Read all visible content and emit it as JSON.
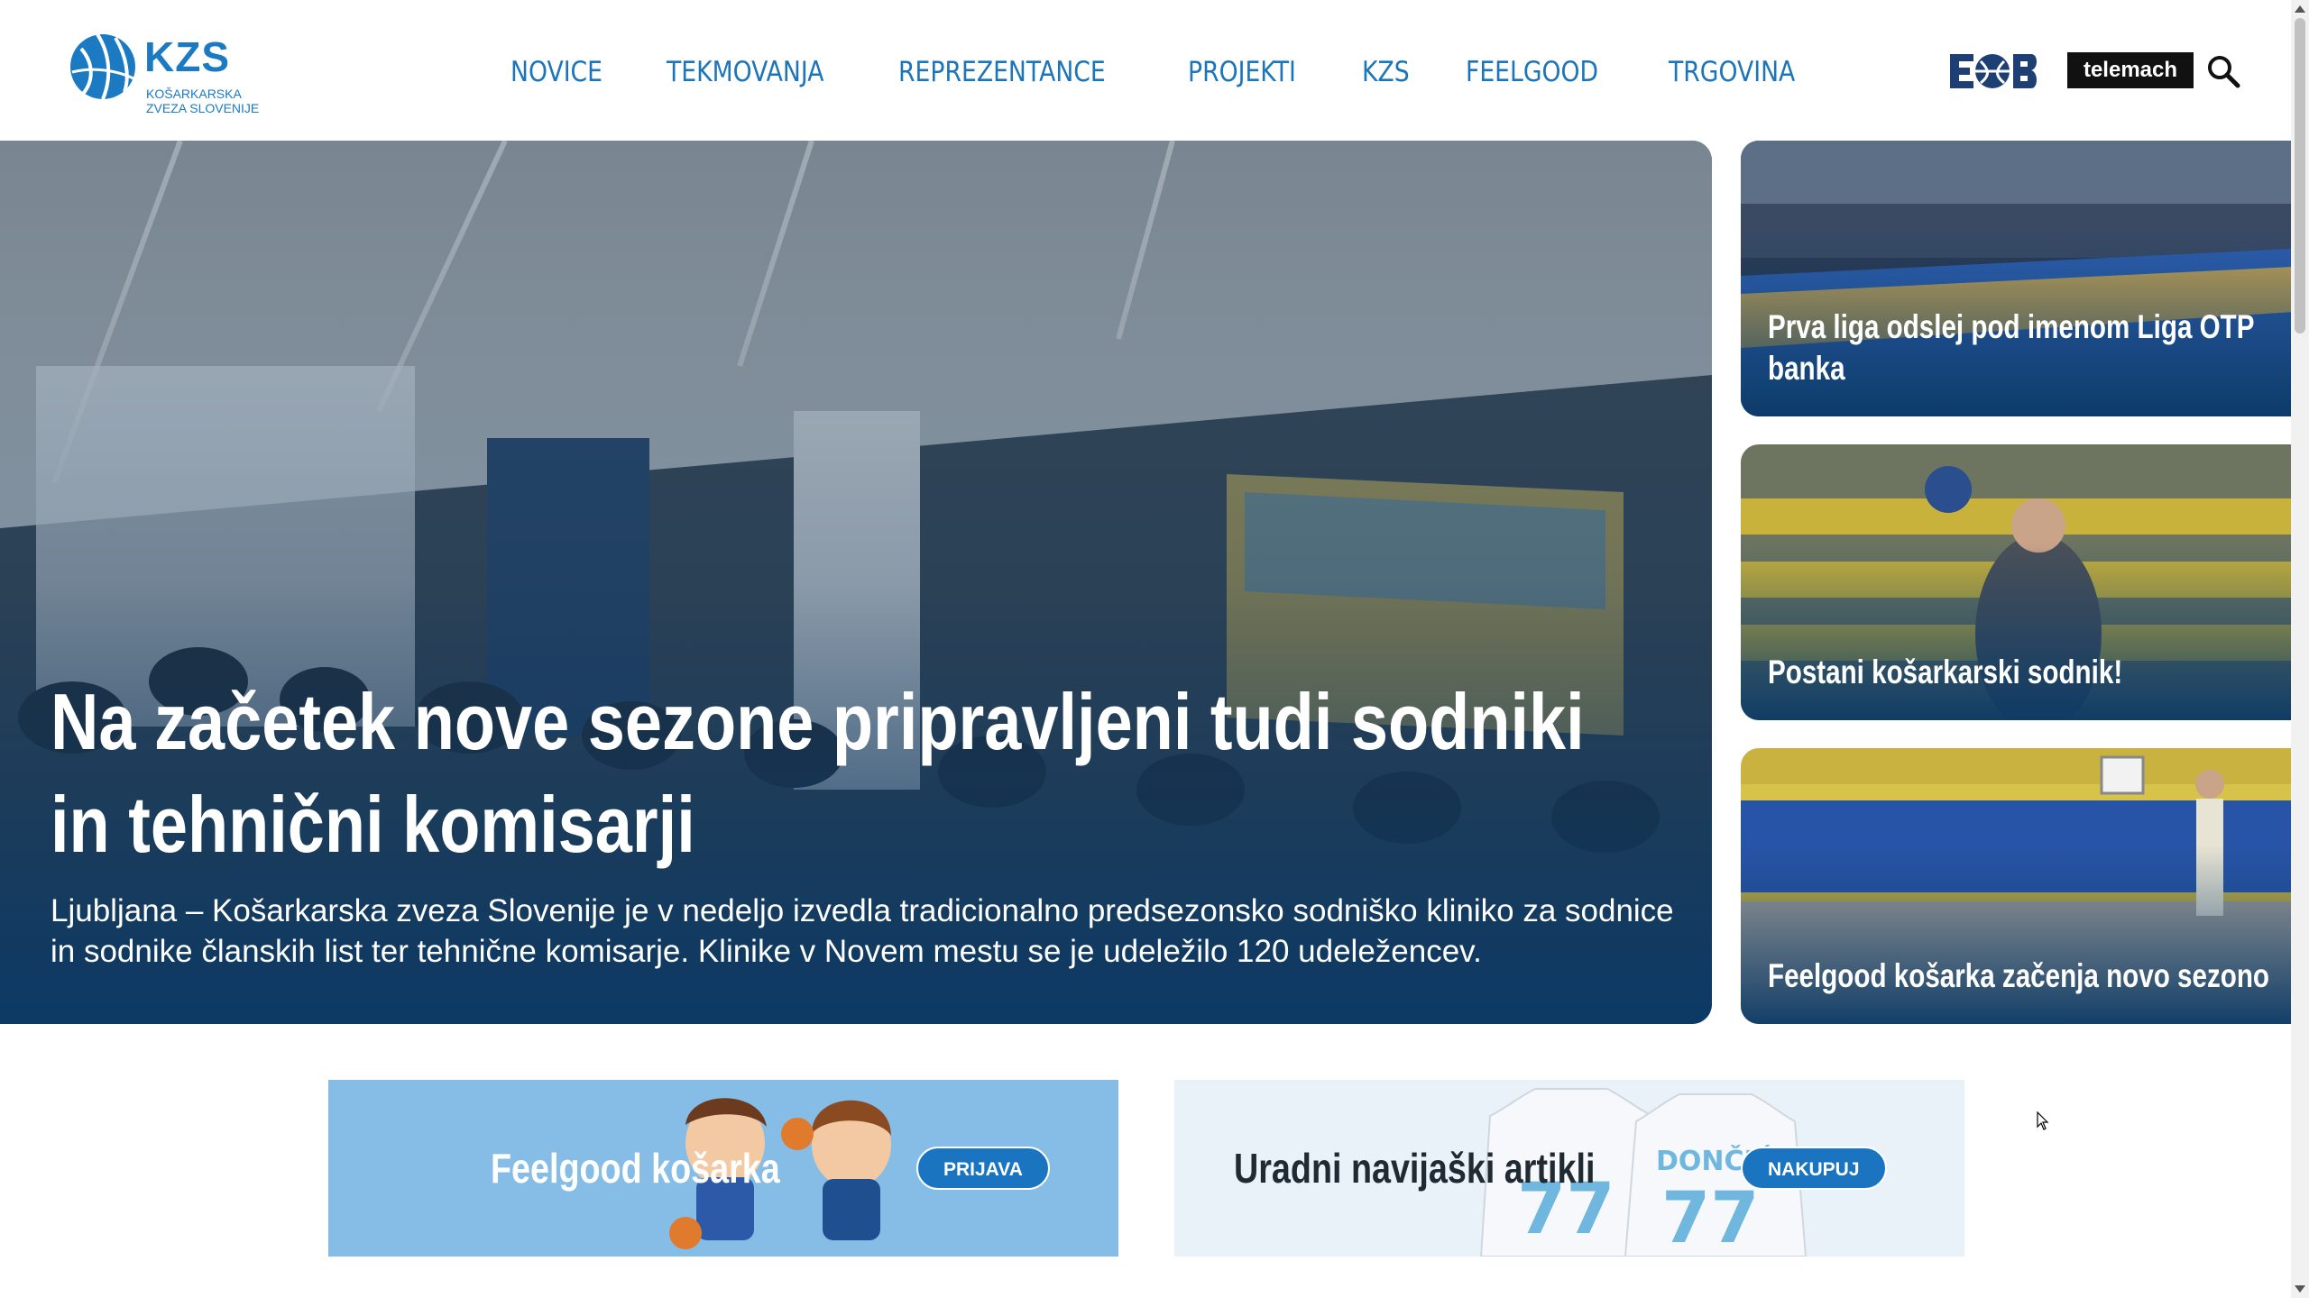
{
  "header": {
    "logo": {
      "title": "KZS",
      "subtitle": "KOŠARKARSKA ZVEZA SLOVENIJE"
    },
    "nav": [
      {
        "label": "NOVICE"
      },
      {
        "label": "TEKMOVANJA"
      },
      {
        "label": "REPREZENTANCE"
      },
      {
        "label": "PROJEKTI"
      },
      {
        "label": "KZS"
      },
      {
        "label": "FEELGOOD"
      },
      {
        "label": "TRGOVINA"
      }
    ],
    "partners": {
      "eob_label": "EOB",
      "telemach_label": "telemach"
    },
    "search_icon": "search-icon"
  },
  "hero": {
    "title": "Na začetek nove sezone pripravljeni tudi sodniki in tehnični komisarji",
    "excerpt": "Ljubljana – Košarkarska zveza Slovenije je v nedeljo izvedla tradicionalno predsezonsko sodniško kliniko za sodnice in sodnike članskih list ter tehnične komisarje. Klinike v Novem mestu se je udeležilo 120 udeležencev."
  },
  "side_cards": [
    {
      "title": "Prva liga odslej pod imenom Liga OTP banka"
    },
    {
      "title": "Postani košarkarski sodnik!"
    },
    {
      "title": "Feelgood košarka začenja novo sezono"
    }
  ],
  "banners": [
    {
      "title": "Feelgood košarka",
      "button": "PRIJAVA"
    },
    {
      "title": "Uradni navijaški artikli",
      "button": "NAKUPUJ",
      "jersey_name": "DONČIĆ",
      "jersey_number": "77"
    }
  ],
  "colors": {
    "brand_blue": "#1b75b8",
    "button_blue": "#1a74bf",
    "overlay_navy": "#0d3a63"
  }
}
